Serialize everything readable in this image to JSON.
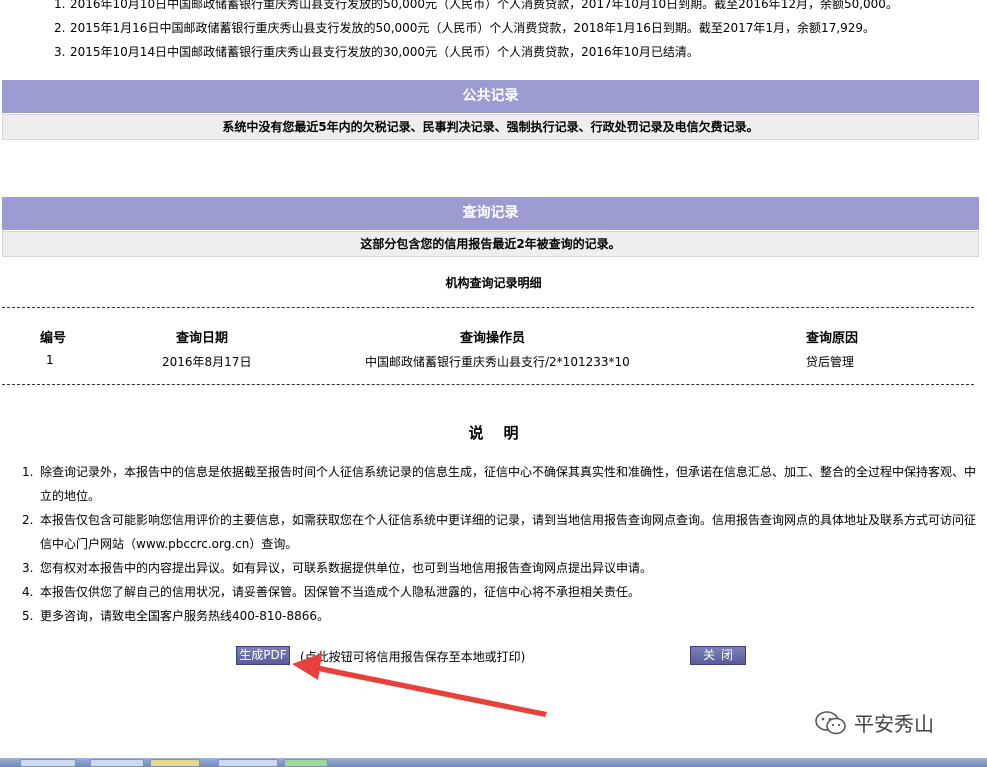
{
  "loans": [
    {
      "num": "1.",
      "text": "2016年10月10日中国邮政储蓄银行重庆秀山县支行发放的50,000元（人民币）个人消费贷款，2017年10月10日到期。截至2016年12月，余额50,000。"
    },
    {
      "num": "2.",
      "text": "2015年1月16日中国邮政储蓄银行重庆秀山县支行发放的50,000元（人民币）个人消费贷款，2018年1月16日到期。截至2017年1月，余额17,929。"
    },
    {
      "num": "3.",
      "text": "2015年10月14日中国邮政储蓄银行重庆秀山县支行发放的30,000元（人民币）个人消费贷款，2016年10月已结清。"
    }
  ],
  "public_records": {
    "title": "公共记录",
    "note": "系统中没有您最近5年内的欠税记录、民事判决记录、强制执行记录、行政处罚记录及电信欠费记录。"
  },
  "query_records": {
    "title": "查询记录",
    "note": "这部分包含您的信用报告最近2年被查询的记录。",
    "detail_title": "机构查询记录明细",
    "columns": [
      "编号",
      "查询日期",
      "查询操作员",
      "查询原因"
    ],
    "rows": [
      [
        "1",
        "2016年8月17日",
        "中国邮政储蓄银行重庆秀山县支行/2*101233*10",
        "贷后管理"
      ]
    ]
  },
  "explanation": {
    "title": "说明",
    "items": [
      {
        "num": "1.",
        "text": "除查询记录外，本报告中的信息是依据截至报告时间个人征信系统记录的信息生成，征信中心不确保其真实性和准确性，但承诺在信息汇总、加工、整合的全过程中保持客观、中立的地位。"
      },
      {
        "num": "2.",
        "text": "本报告仅包含可能影响您信用评价的主要信息，如需获取您在个人征信系统中更详细的记录，请到当地信用报告查询网点查询。信用报告查询网点的具体地址及联系方式可访问征信中心门户网站（www.pbccrc.org.cn）查询。"
      },
      {
        "num": "3.",
        "text": "您有权对本报告中的内容提出异议。如有异议，可联系数据提供单位，也可到当地信用报告查询网点提出异议申请。"
      },
      {
        "num": "4.",
        "text": "本报告仅供您了解自己的信用状况，请妥善保管。因保管不当造成个人隐私泄露的，征信中心将不承担相关责任。"
      },
      {
        "num": "5.",
        "text": "更多咨询，请致电全国客户服务热线400-810-8866。"
      }
    ]
  },
  "actions": {
    "pdf_label": "生成PDF",
    "hint": "(点此按钮可将信用报告保存至本地或打印)",
    "close_label": "关闭"
  },
  "watermark": {
    "text": "平安秀山",
    "icon": "wechat-icon"
  },
  "colors": {
    "header_bg": "#9b9bd1",
    "sub_bg": "#efeded",
    "button": "#6a6aa8",
    "arrow": "#e8413c"
  }
}
